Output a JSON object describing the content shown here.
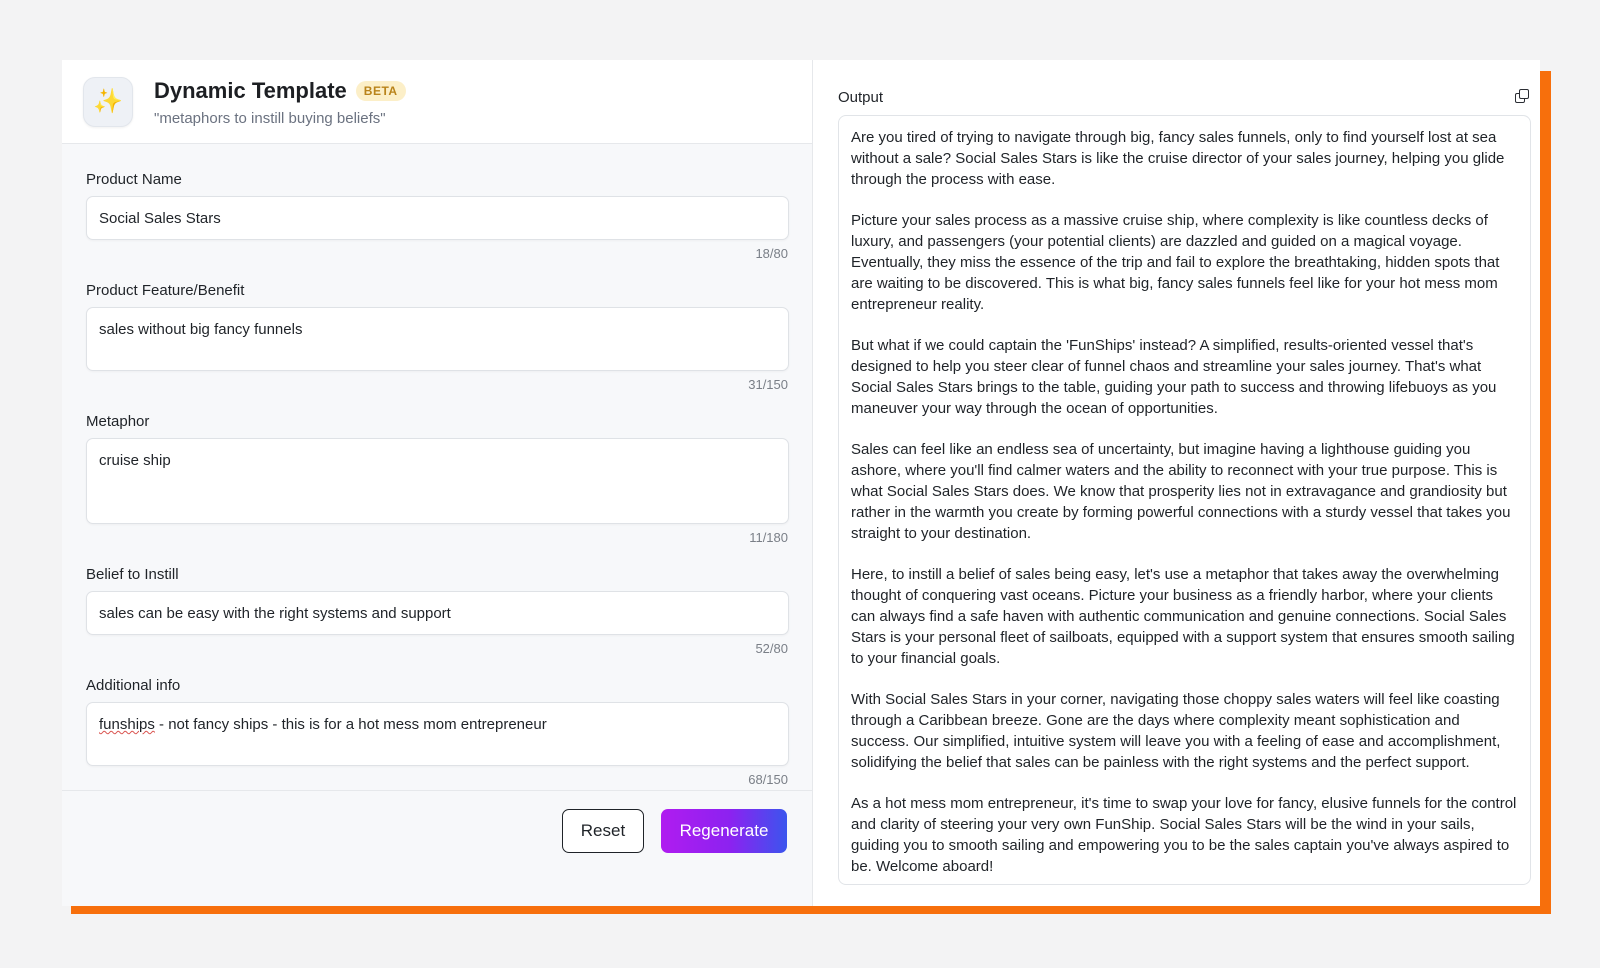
{
  "header": {
    "title": "Dynamic Template",
    "badge": "BETA",
    "subtitle": "\"metaphors to instill buying beliefs\"",
    "logo_icon": "sparkles-icon"
  },
  "form": {
    "fields": [
      {
        "label": "Product Name",
        "value": "Social Sales Stars",
        "counter": "18/80"
      },
      {
        "label": "Product Feature/Benefit",
        "value": "sales without big fancy funnels",
        "counter": "31/150"
      },
      {
        "label": "Metaphor",
        "value": "cruise ship",
        "counter": "11/180"
      },
      {
        "label": "Belief to Instill",
        "value": "sales can be easy with the right systems and support",
        "counter": "52/80"
      },
      {
        "label": "Additional info",
        "value_misspelled": "funships",
        "value_rest": " - not fancy ships - this is for a hot mess mom entrepreneur",
        "counter": "68/150"
      }
    ]
  },
  "buttons": {
    "reset": "Reset",
    "regenerate": "Regenerate"
  },
  "output": {
    "label": "Output",
    "copy_icon": "copy-icon",
    "paragraphs": [
      "Are you tired of trying to navigate through big, fancy sales funnels, only to find yourself lost at sea without a sale? Social Sales Stars is like the cruise director of your sales journey, helping you glide through the process with ease.",
      "Picture your sales process as a massive cruise ship, where complexity is like countless decks of luxury, and passengers (your potential clients) are dazzled and guided on a magical voyage. Eventually, they miss the essence of the trip and fail to explore the breathtaking, hidden spots that are waiting to be discovered. This is what big, fancy sales funnels feel like for your hot mess mom entrepreneur reality.",
      "But what if we could captain the 'FunShips' instead? A simplified, results-oriented vessel that's designed to help you steer clear of funnel chaos and streamline your sales journey. That's what Social Sales Stars brings to the table, guiding your path to success and throwing lifebuoys as you maneuver your way through the ocean of opportunities.",
      "Sales can feel like an endless sea of uncertainty, but imagine having a lighthouse guiding you ashore, where you'll find calmer waters and the ability to reconnect with your true purpose. This is what Social Sales Stars does. We know that prosperity lies not in extravagance and grandiosity but rather in the warmth you create by forming powerful connections with a sturdy vessel that takes you straight to your destination.",
      "Here, to instill a belief of sales being easy, let's use a metaphor that takes away the overwhelming thought of conquering vast oceans. Picture your business as a friendly harbor, where your clients can always find a safe haven with authentic communication and genuine connections. Social Sales Stars is your personal fleet of sailboats, equipped with a support system that ensures smooth sailing to your financial goals.",
      "With Social Sales Stars in your corner, navigating those choppy sales waters will feel like coasting through a Caribbean breeze. Gone are the days where complexity meant sophistication and success. Our simplified, intuitive system will leave you with a feeling of ease and accomplishment, solidifying the belief that sales can be painless with the right systems and the perfect support.",
      "As a hot mess mom entrepreneur, it's time to swap your love for fancy, elusive funnels for the control and clarity of steering your very own FunShip. Social Sales Stars will be the wind in your sails, guiding you to smooth sailing and empowering you to be the sales captain you've always aspired to be. Welcome aboard!"
    ]
  },
  "colors": {
    "accent_orange": "#f76f0c",
    "regenerate_gradient_start": "#b01cf0",
    "regenerate_gradient_end": "#3b55ee",
    "beta_bg": "#fcefc8"
  }
}
